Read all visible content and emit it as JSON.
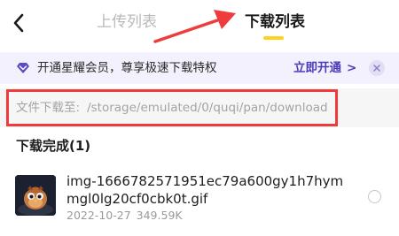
{
  "header": {
    "back_icon": "chevron-left-icon",
    "tabs": [
      {
        "label": "上传列表",
        "active": false
      },
      {
        "label": "下载列表",
        "active": true
      }
    ],
    "indicator_color": "#ffd21e"
  },
  "promo": {
    "icon": "diamond-icon",
    "text": "开通星耀会员，尊享极速下载特权",
    "link_label": "立即开通",
    "link_icon": ">",
    "close_icon": "close-icon",
    "accent_color": "#4a3bb8"
  },
  "download_path": {
    "label": "文件下载至:",
    "value": "/storage/emulated/0/quqi/pan/download"
  },
  "annotation": {
    "color": "#ef3b3b"
  },
  "section": {
    "title": "下载完成(1)"
  },
  "files": [
    {
      "name": "img-1666782571951ec79a600gy1h7hymmgl0lg20cf0cbk0t.gif",
      "date": "2022-10-27",
      "size": "349.59K",
      "selected": false
    }
  ]
}
